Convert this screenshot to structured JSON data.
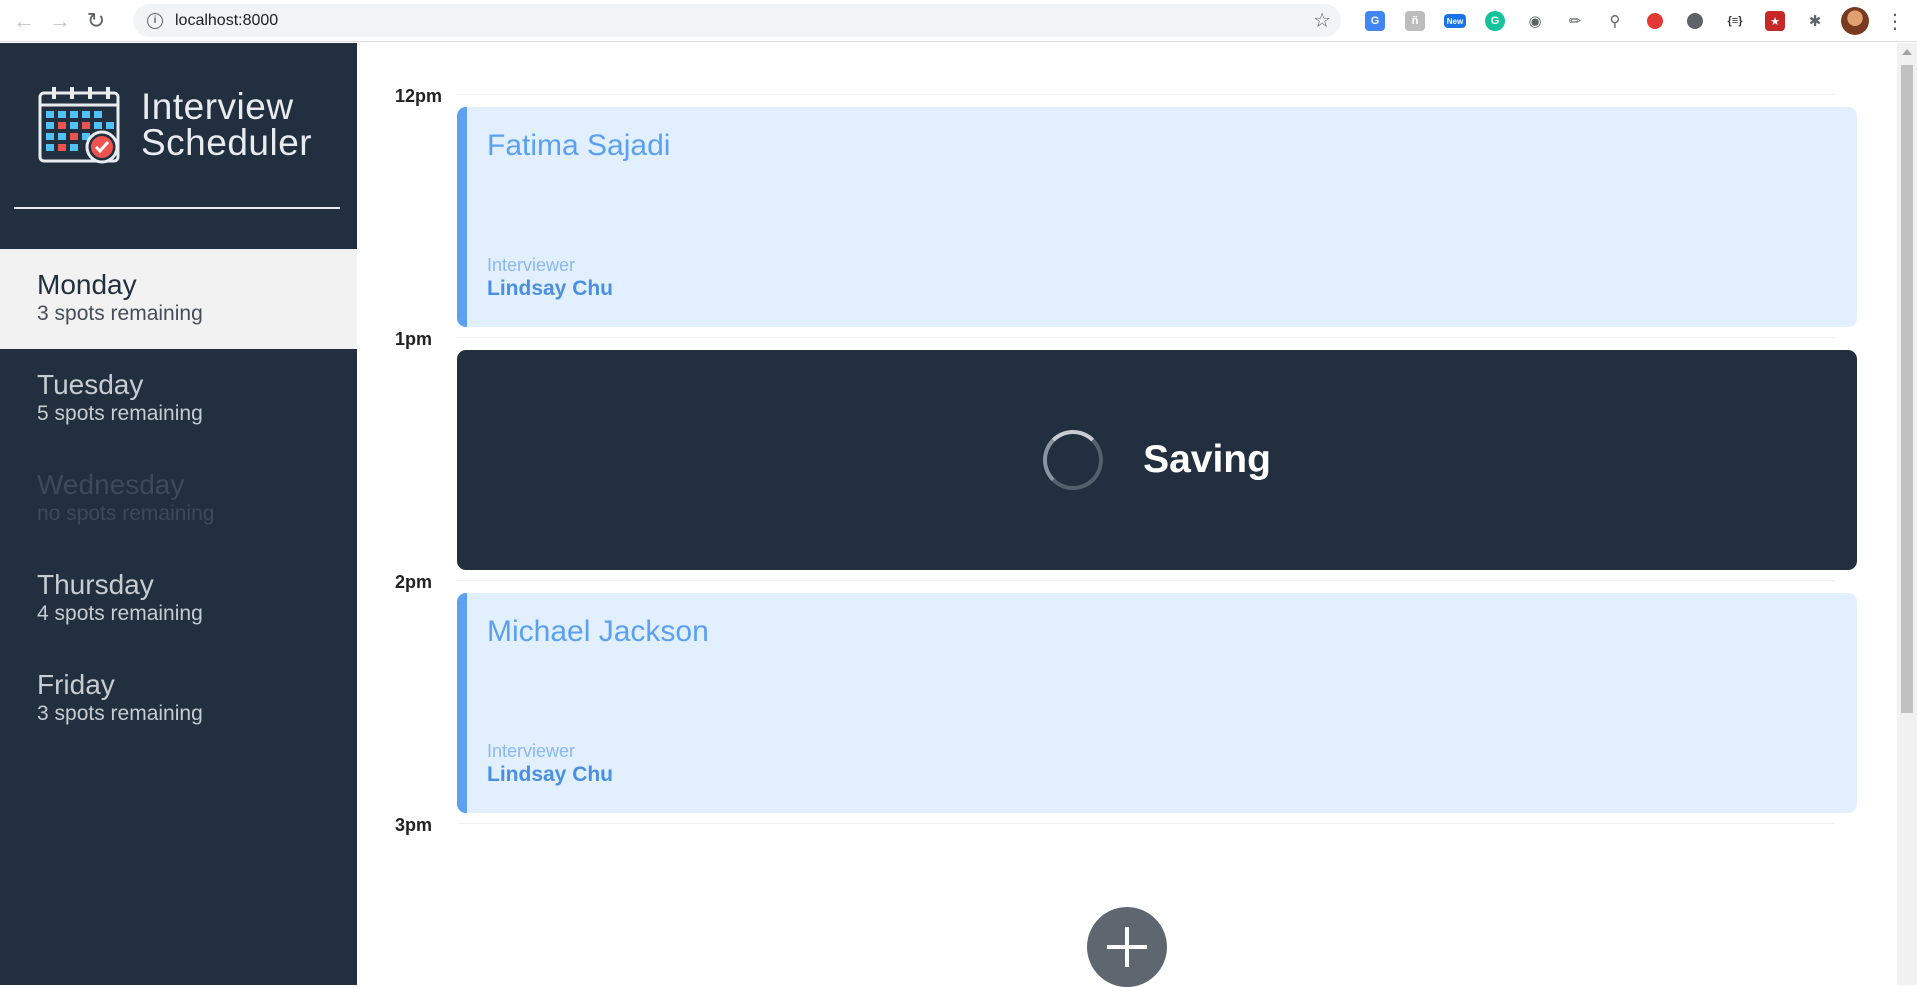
{
  "browser": {
    "url": "localhost:8000",
    "extensions": [
      "google-translate-icon",
      "reader-icon",
      "new-badge-icon",
      "grammarly-icon",
      "camera-icon",
      "eyedropper-icon",
      "magnifier-icon",
      "record-icon",
      "circle-icon",
      "json-icon",
      "puzzle-game-icon",
      "extensions-icon"
    ],
    "new_badge": "New",
    "json_ext_label": "{≡}"
  },
  "app": {
    "title_line1": "Interview",
    "title_line2": "Scheduler"
  },
  "days": [
    {
      "name": "Monday",
      "spots": "3 spots remaining",
      "state": "selected"
    },
    {
      "name": "Tuesday",
      "spots": "5 spots remaining",
      "state": "normal"
    },
    {
      "name": "Wednesday",
      "spots": "no spots remaining",
      "state": "full"
    },
    {
      "name": "Thursday",
      "spots": "4 spots remaining",
      "state": "normal"
    },
    {
      "name": "Friday",
      "spots": "3 spots remaining",
      "state": "normal"
    }
  ],
  "schedule": {
    "times": [
      "12pm",
      "1pm",
      "2pm",
      "3pm"
    ],
    "appointments": [
      {
        "time": "12pm",
        "student": "Fatima Sajadi",
        "interviewer_label": "Interviewer",
        "interviewer": "Lindsay Chu"
      },
      {
        "time": "1pm",
        "status": "Saving"
      },
      {
        "time": "2pm",
        "student": "Michael Jackson",
        "interviewer_label": "Interviewer",
        "interviewer": "Lindsay Chu"
      }
    ]
  },
  "colors": {
    "sidebar_bg": "#222f3e",
    "appointment_bg": "#e2efff",
    "appointment_accent": "#5ba1f3",
    "status_bg": "#222f3e"
  }
}
